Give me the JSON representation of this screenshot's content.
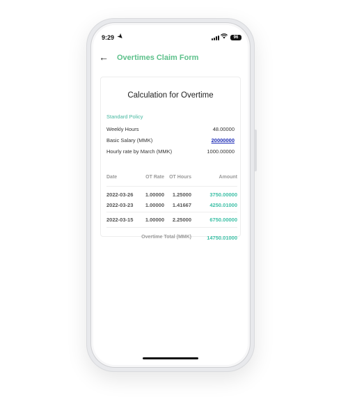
{
  "status": {
    "time": "9:29",
    "battery": "96"
  },
  "nav": {
    "title": "Overtimes Claim Form"
  },
  "card": {
    "title": "Calculation for Overtime",
    "policy": "Standard Policy",
    "rows": [
      {
        "label": "Weekly Hours",
        "value": "48.00000"
      },
      {
        "label": "Basic Salary (MMK)",
        "value": "20000000"
      },
      {
        "label": "Hourly rate by March (MMK)",
        "value": "1000.00000"
      }
    ]
  },
  "table": {
    "headers": [
      "Date",
      "OT Rate",
      "OT Hours",
      "Amount"
    ],
    "rows": [
      {
        "date": "2022-03-26",
        "rate": "1.00000",
        "hours": "1.25000",
        "amount": "3750.00000"
      },
      {
        "date": "2022-03-23",
        "rate": "1.00000",
        "hours": "1.41667",
        "amount": "4250.01000"
      },
      {
        "date": "2022-03-15",
        "rate": "1.00000",
        "hours": "2.25000",
        "amount": "6750.00000"
      }
    ],
    "total_label": "Overtime Total (MMK)",
    "total_value": "14750.01000"
  },
  "colors": {
    "accent_green": "#5cc08a",
    "amount_teal": "#3bbfa5",
    "link_blue": "#1c2bb6"
  }
}
